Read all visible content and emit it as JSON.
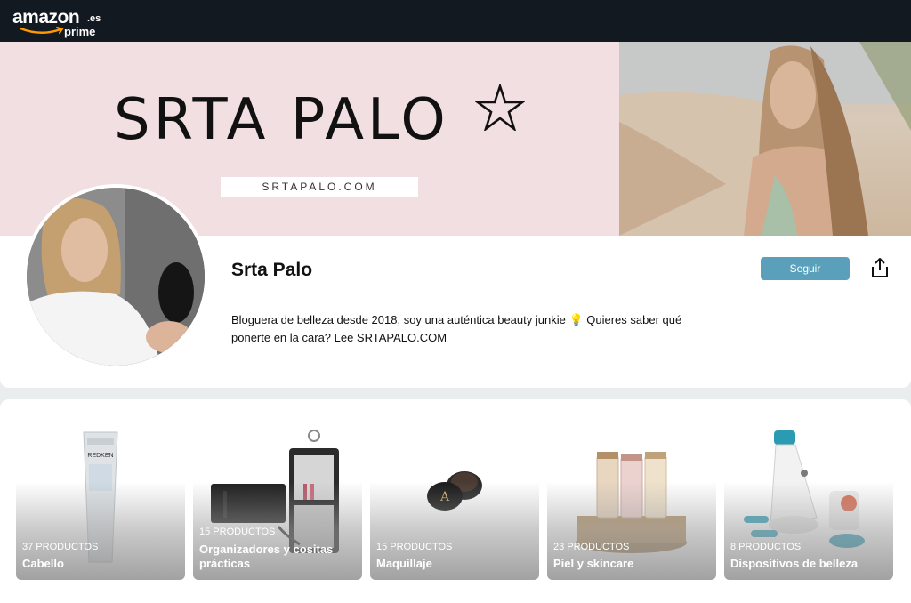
{
  "header": {
    "logo_word": "amazon",
    "logo_tld": ".es",
    "logo_sub": "prime"
  },
  "banner": {
    "title": "SRTA PALO",
    "url": "SRTAPALO.COM"
  },
  "profile": {
    "name": "Srta Palo",
    "bio": "Bloguera de belleza desde 2018, soy una auténtica beauty junkie 💡 Quieres saber qué ponerte en la cara? Lee SRTAPALO.COM",
    "follow_label": "Seguir"
  },
  "collections": [
    {
      "count": "37 PRODUCTOS",
      "label": "Cabello",
      "icon": "hair-product-tube"
    },
    {
      "count": "15 PRODUCTOS",
      "label": "Organizadores y cositas prácticas",
      "icon": "hanging-organizer"
    },
    {
      "count": "15 PRODUCTOS",
      "label": "Maquillaje",
      "icon": "brow-pomade-jar"
    },
    {
      "count": "23 PRODUCTOS",
      "label": "Piel y skincare",
      "icon": "capsule-jars"
    },
    {
      "count": "8 PRODUCTOS",
      "label": "Dispositivos de belleza",
      "icon": "beauty-device"
    }
  ],
  "colors": {
    "topbar": "#131921",
    "banner_bg": "#f2dfe2",
    "follow_button": "#5aa0bb"
  }
}
